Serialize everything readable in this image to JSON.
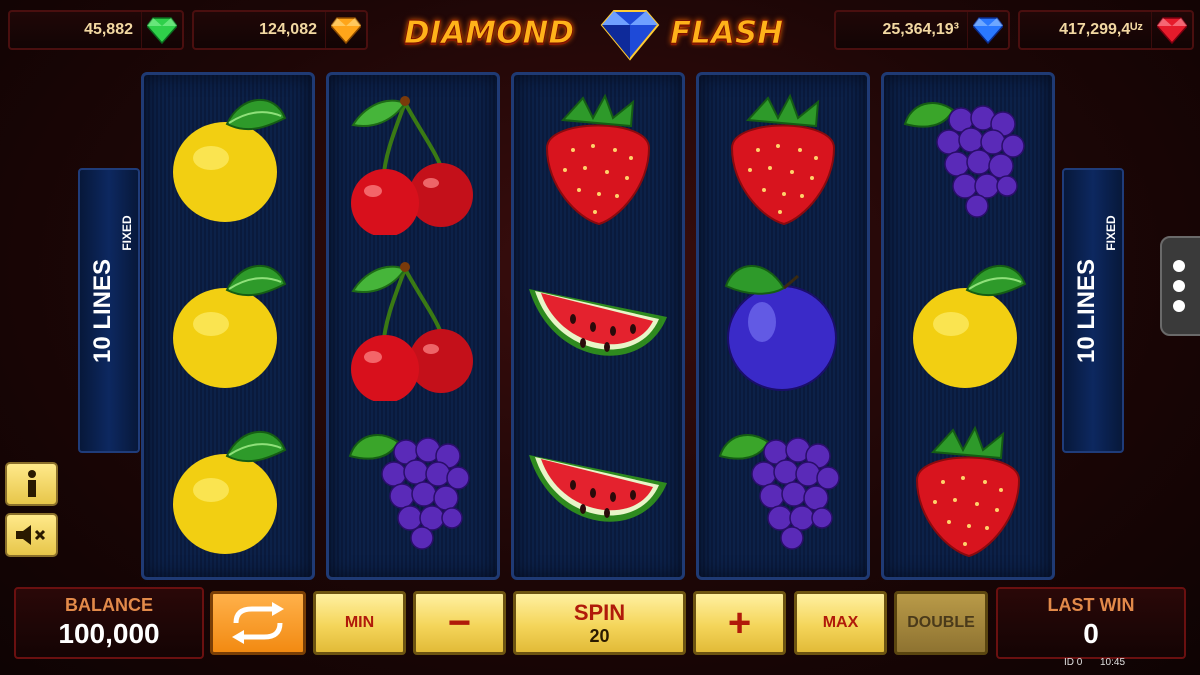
{
  "jackpots": [
    {
      "value": "45,882",
      "gem": "green-gem-icon",
      "color": "#2fd04a"
    },
    {
      "value": "124,082",
      "gem": "orange-gem-icon",
      "color": "#ffa51a"
    },
    {
      "value": "25,364,19³",
      "gem": "blue-gem-icon",
      "color": "#2a78ff"
    },
    {
      "value": "417,299,4ᵁᶻ",
      "gem": "red-gem-icon",
      "color": "#e51b2b"
    }
  ],
  "logo": {
    "word1": "DIAMOND",
    "word2": "FLASH"
  },
  "side_panel": {
    "lines": "10 LINES",
    "fixed": "FIXED"
  },
  "reels": [
    [
      "lemon",
      "lemon",
      "lemon"
    ],
    [
      "cherry",
      "cherry",
      "grapes"
    ],
    [
      "strawberry",
      "watermelon",
      "watermelon"
    ],
    [
      "strawberry",
      "plum",
      "grapes"
    ],
    [
      "grapes",
      "lemon",
      "strawberry"
    ]
  ],
  "controls": {
    "balance_label": "BALANCE",
    "balance_value": "100,000",
    "min": "MIN",
    "minus": "−",
    "spin": "SPIN",
    "spin_lines": "20",
    "plus": "+",
    "max": "MAX",
    "double": "DOUBLE",
    "last_win_label": "LAST WIN",
    "last_win_value": "0"
  },
  "status": {
    "id": "ID 0",
    "time": "10:45"
  },
  "colors": {
    "accent": "#f4d55a",
    "reel_border": "#1f3a74",
    "logo": "#ffb21a"
  }
}
